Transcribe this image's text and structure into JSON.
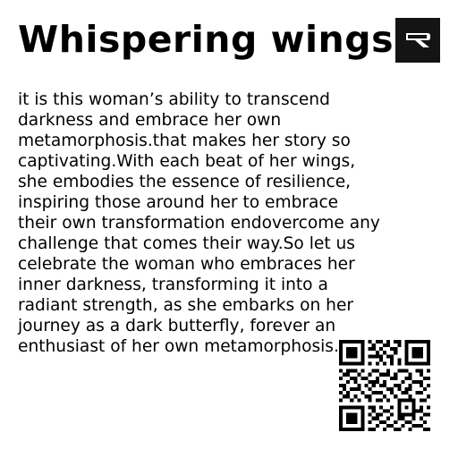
{
  "title": "Whispering wings",
  "logo_icon": "brand-logo-icon",
  "body_lines": [
    "it is this woman’s ability to transcend",
    "darkness and embrace her own",
    "metamorphosis.that makes her story so",
    "captivating.With each beat of her wings,",
    "she embodies the essence of resilience,",
    "inspiring those around her to embrace",
    "their own transformation endovercome any",
    "challenge that comes their way.So let us",
    "celebrate the woman who embraces her",
    "inner darkness, transforming it into a",
    "radiant strength, as she embarks on her",
    "journey as a dark butterfly, forever an",
    "enthusiast of her own metamorphosis."
  ],
  "qr_icon": "qr-code-icon"
}
